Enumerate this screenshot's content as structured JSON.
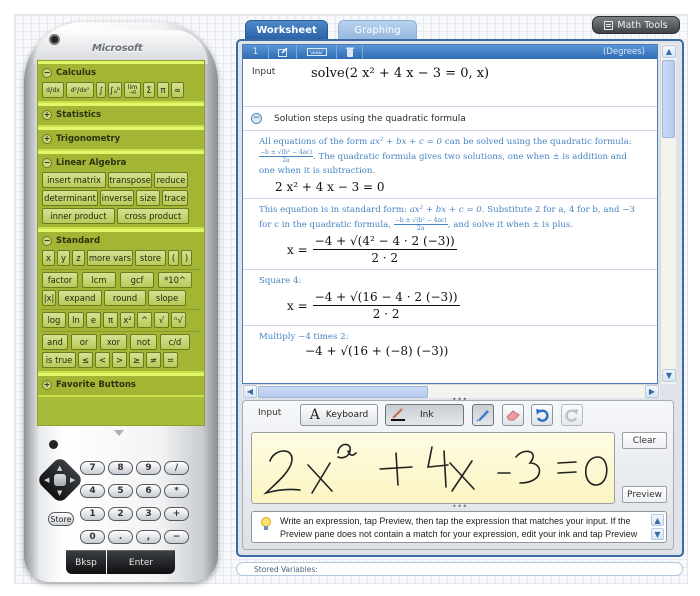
{
  "phone": {
    "brand": "Microsoft",
    "sections": [
      {
        "title": "Calculus",
        "expanded": true,
        "buttons": [
          [
            "d/dx",
            "d²/dx²",
            "∫",
            "∫ₐᵇ",
            "lim",
            "Σ",
            "π",
            "∞"
          ]
        ]
      },
      {
        "title": "Statistics",
        "expanded": false
      },
      {
        "title": "Trigonometry",
        "expanded": false
      },
      {
        "title": "Linear Algebra",
        "expanded": true,
        "buttons": [
          [
            "insert matrix",
            "transpose",
            "reduce"
          ],
          [
            "determinant",
            "inverse",
            "size",
            "trace"
          ],
          [
            "inner product",
            "cross product"
          ]
        ]
      },
      {
        "title": "Standard",
        "expanded": true,
        "buttons": [
          [
            "x",
            "y",
            "z",
            "more vars",
            "store",
            "(",
            ")"
          ],
          [
            "factor",
            "lcm",
            "gcf",
            "*10^"
          ],
          [
            "|x|",
            "expand",
            "round",
            "slope"
          ],
          [
            "log",
            "ln",
            "e",
            "π",
            "x²",
            "^",
            "√",
            "ⁿ√"
          ],
          [
            "and",
            "or",
            "xor",
            "not",
            "c/d"
          ],
          [
            "is true",
            "≤",
            "<",
            ">",
            "≥",
            "≠",
            "="
          ]
        ]
      },
      {
        "title": "Favorite Buttons",
        "expanded": false
      }
    ],
    "keypad": [
      [
        "7",
        "8",
        "9",
        "/"
      ],
      [
        "4",
        "5",
        "6",
        "*"
      ],
      [
        "1",
        "2",
        "3",
        "+"
      ],
      [
        "0",
        ".",
        ",",
        "−"
      ]
    ],
    "store_label": "Store",
    "bksp_label": "Bksp",
    "enter_label": "Enter"
  },
  "tabs": [
    {
      "label": "Worksheet",
      "active": true
    },
    {
      "label": "Graphing",
      "active": false
    }
  ],
  "math_tools_label": "Math Tools",
  "worksheet": {
    "entry_number": "1",
    "angle_mode": "(Degrees)",
    "input_label": "Input",
    "input_expression": "solve(2 x² + 4 x − 3 = 0, x)",
    "steps_title": "Solution steps using the quadratic formula",
    "steps": [
      {
        "desc_a": "All equations of the form",
        "desc_form": "ax² + bx + c = 0",
        "desc_b": "can be solved using the quadratic formula:",
        "formula_num": "−b ± √(b² − 4ac)",
        "formula_den": "2a",
        "desc_c": ". The quadratic formula gives two solutions, one when ± is addition and one when it is subtraction.",
        "result": "2 x² + 4 x − 3 = 0"
      },
      {
        "desc_a": "This equation is in standard form:",
        "desc_form": "ax² + bx + c = 0",
        "desc_b": ". Substitute 2 for a, 4 for b, and −3 for c in the quadratic formula,",
        "desc_c": ", and solve it when ± is plus.",
        "result_lhs": "x =",
        "result_num": "−4 + √(4² − 4 · 2 (−3))",
        "result_den": "2 · 2"
      },
      {
        "desc": "Square 4:",
        "result_lhs": "x =",
        "result_num": "−4 + √(16 − 4 · 2 (−3))",
        "result_den": "2 · 2"
      },
      {
        "desc": "Multiply −4 times 2:",
        "result_num": "−4 + √(16 + (−8) (−3))"
      }
    ]
  },
  "input_panel": {
    "label": "Input",
    "keyboard_label": "Keyboard",
    "ink_label": "Ink",
    "handwriting": "2x² + 4x − 3 = 0",
    "clear_label": "Clear",
    "preview_label": "Preview",
    "tip": "Write an expression, tap Preview, then tap the expression that matches your input. If the Preview pane does not contain a match for your expression, edit your ink and tap Preview"
  },
  "stored_variables_label": "Stored Variables:"
}
